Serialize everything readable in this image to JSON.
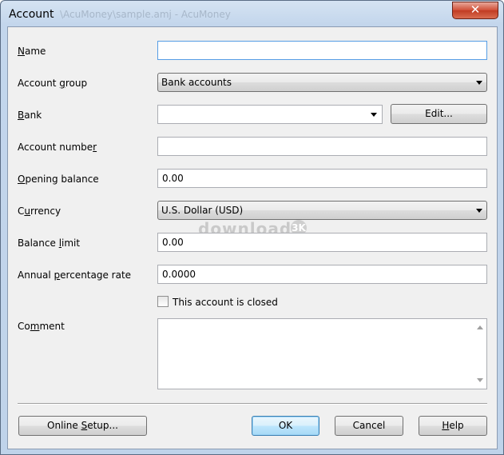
{
  "window": {
    "title": "Account",
    "title_ghost": "\\AcuMoney\\sample.amj - AcuMoney",
    "close_symbol": "✕"
  },
  "form": {
    "name": {
      "label": "Name",
      "value": ""
    },
    "account_group": {
      "label": "Account group",
      "value": "Bank accounts"
    },
    "bank": {
      "label": "Bank",
      "value": "",
      "edit_button": "Edit..."
    },
    "account_number": {
      "label": "Account number",
      "value": ""
    },
    "opening_balance": {
      "label": "Opening balance",
      "value": "0.00"
    },
    "currency": {
      "label": "Currency",
      "value": "U.S. Dollar (USD)"
    },
    "balance_limit": {
      "label": "Balance limit",
      "value": "0.00"
    },
    "annual_rate": {
      "label": "Annual percentage rate",
      "value": "0.0000"
    },
    "closed_checkbox": {
      "label": "This account is closed",
      "checked": false
    },
    "comment": {
      "label": "Comment",
      "value": ""
    }
  },
  "buttons": {
    "online_setup": "Online Setup...",
    "ok": "OK",
    "cancel": "Cancel",
    "help": "Help"
  },
  "watermark": {
    "text": "download",
    "badge": "3K"
  },
  "colors": {
    "close_button": "#c13b22",
    "focus_border": "#569de5",
    "default_button": "#3c7fb1"
  }
}
